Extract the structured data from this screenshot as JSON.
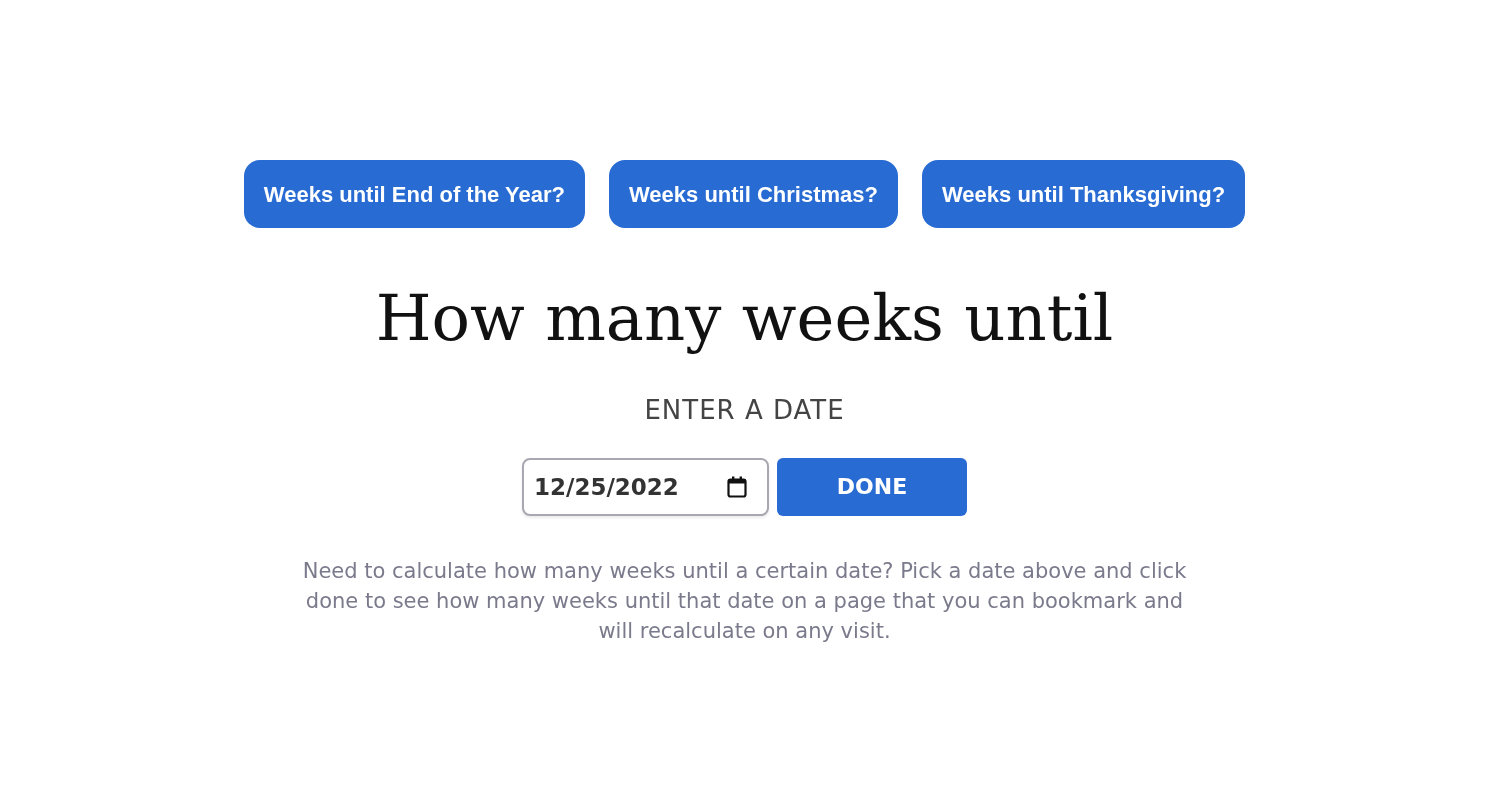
{
  "shortcuts": [
    {
      "label": "Weeks until End of the Year?"
    },
    {
      "label": "Weeks until Christmas?"
    },
    {
      "label": "Weeks until Thanksgiving?"
    }
  ],
  "heading": "How many weeks until",
  "prompt": "ENTER A DATE",
  "date_field": {
    "value": "12/25/2022"
  },
  "submit": "DONE",
  "description": "Need to calculate how many weeks until a certain date? Pick a date above and click done to see how many weeks until that date on a page that you can bookmark and will recalculate on any visit."
}
